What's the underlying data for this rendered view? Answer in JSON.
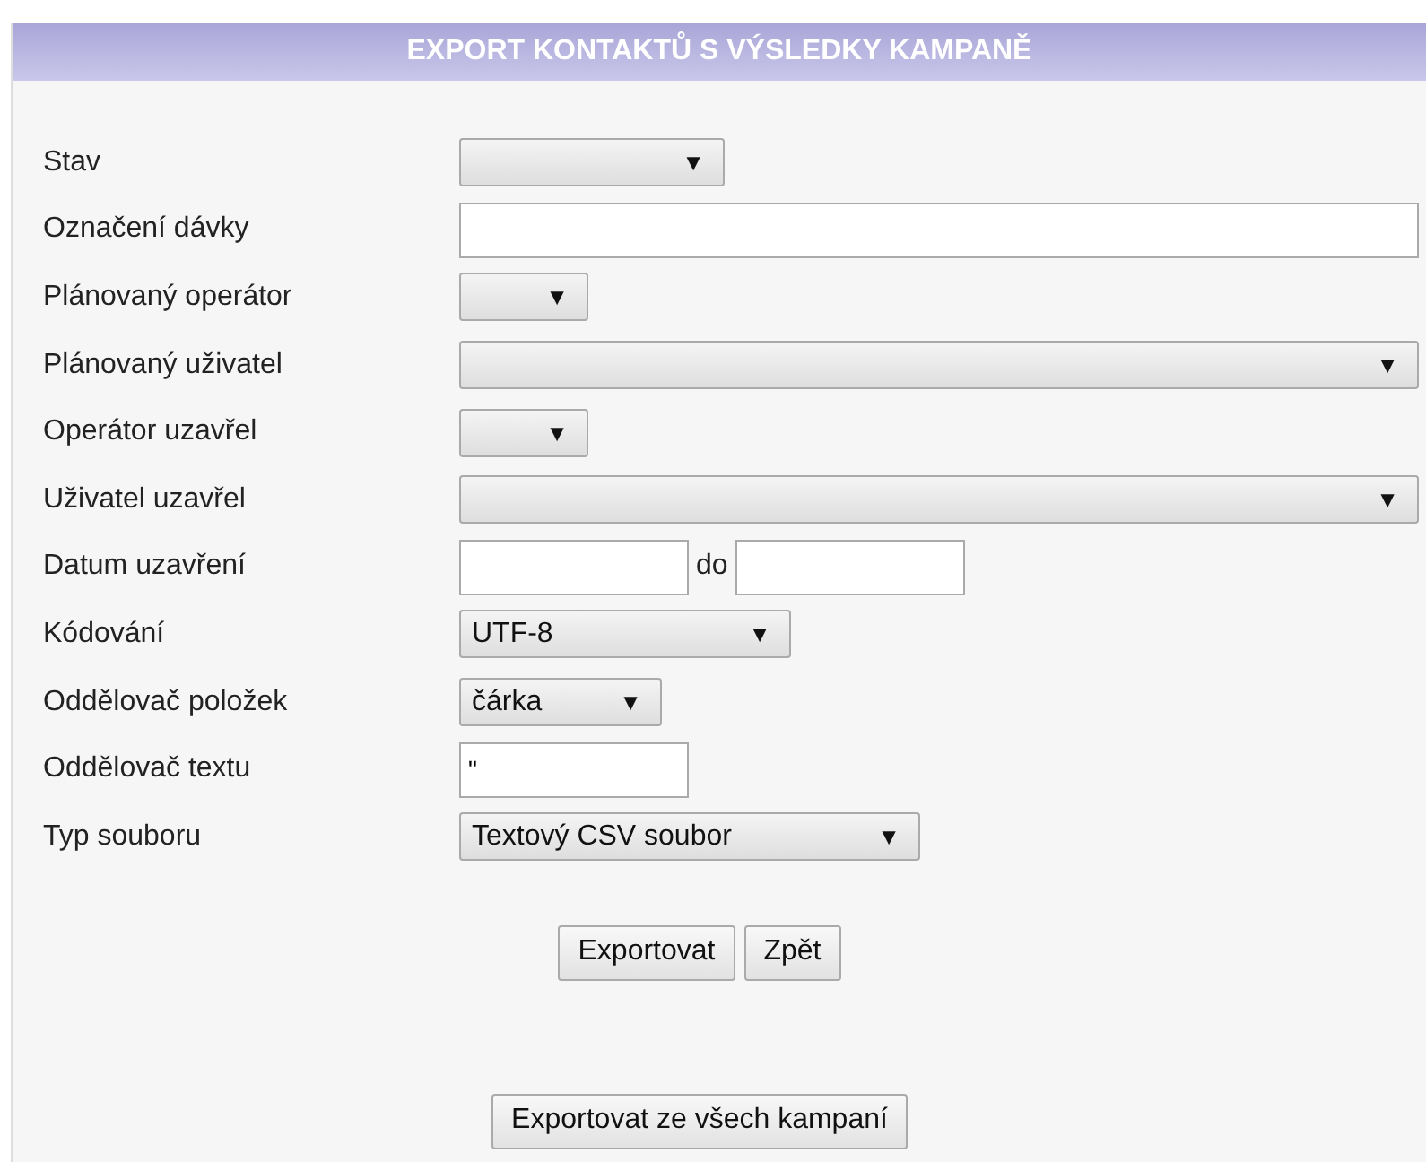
{
  "title": "EXPORT KONTAKTŮ S VÝSLEDKY KAMPANĚ",
  "fields": [
    {
      "label": "Stav",
      "kind": "select"
    },
    {
      "label": "Označení dávky",
      "kind": "text"
    },
    {
      "label": "Plánovaný operátor",
      "kind": "select"
    },
    {
      "label": "Plánovaný uživatel",
      "kind": "select"
    },
    {
      "label": "Operátor uzavřel",
      "kind": "select"
    },
    {
      "label": "Uživatel uzavřel",
      "kind": "select"
    },
    {
      "label": "Datum uzavření",
      "kind": "daterange",
      "separator": "do"
    },
    {
      "label": "Kódování",
      "kind": "select",
      "value": "UTF-8"
    },
    {
      "label": "Oddělovač položek",
      "kind": "select",
      "value": "čárka"
    },
    {
      "label": "Oddělovač textu",
      "kind": "text",
      "value": "\""
    },
    {
      "label": "Typ souboru",
      "kind": "select",
      "value": "Textový CSV soubor"
    }
  ],
  "buttons": [
    "Exportovat",
    "Zpět"
  ],
  "bottom_button": "Exportovat ze všech kampaní",
  "arrow": "▼"
}
